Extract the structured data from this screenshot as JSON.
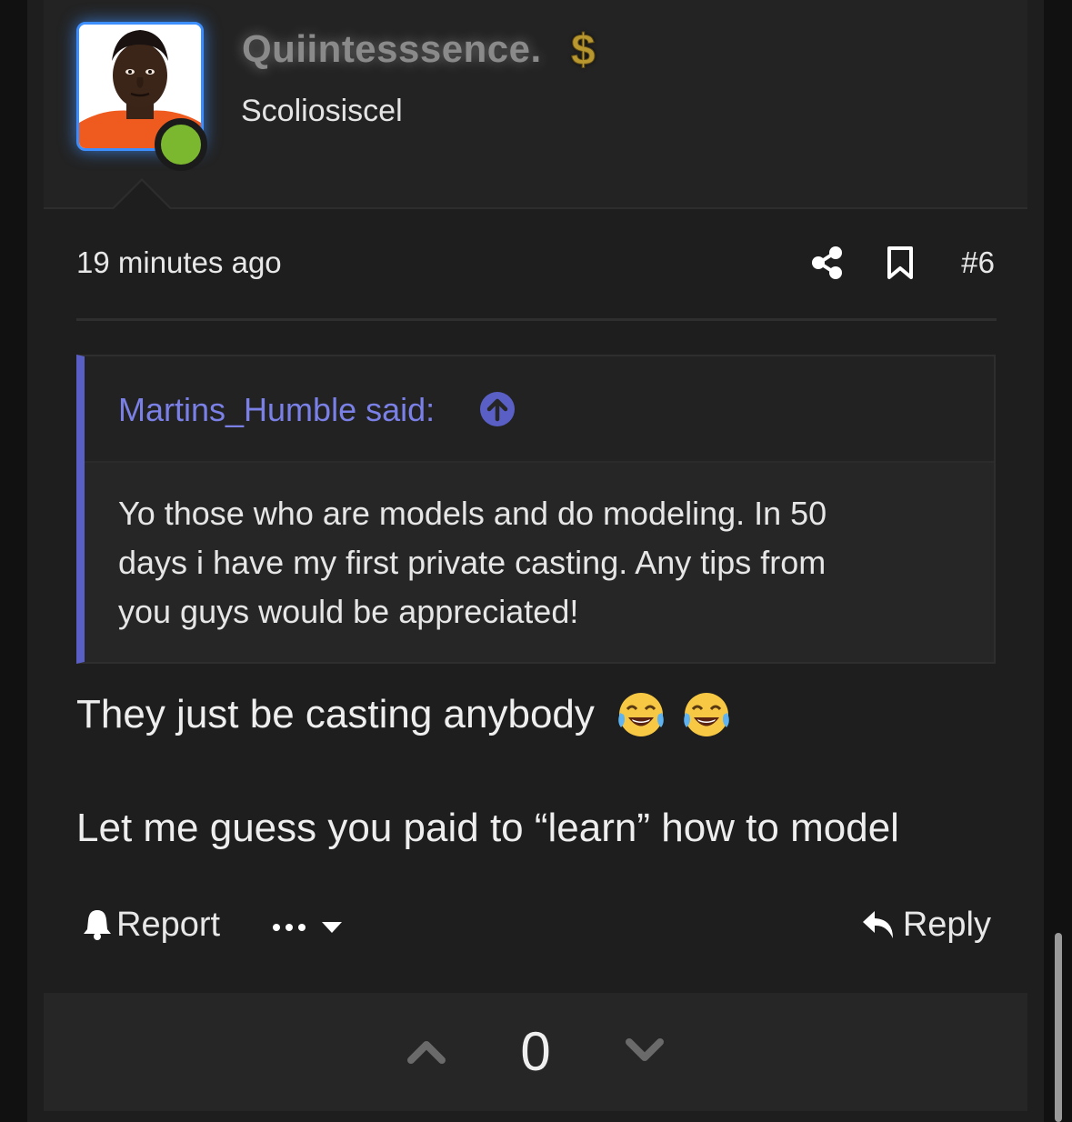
{
  "author": {
    "username": "Quiintesssence.",
    "title": "Scoliosiscel",
    "badge_icon": "dollar-icon",
    "online": true,
    "avatar_border_color": "#3d8fff",
    "online_color": "#7cb82f"
  },
  "post": {
    "timestamp": "19 minutes ago",
    "number": "#6",
    "icons": [
      "share-icon",
      "bookmark-icon"
    ]
  },
  "quote": {
    "author_label": "Martins_Humble said:",
    "accent_color": "#5a5fc6",
    "lines": [
      "Yo those who are models and do modeling. In 50",
      "days i have my first private casting. Any tips from",
      "you guys would be appreciated!"
    ]
  },
  "message": {
    "line1": "They just be casting anybody",
    "line1_emojis": [
      "tears-of-joy-emoji",
      "tears-of-joy-emoji"
    ],
    "line2": "Let me guess you paid to “learn” how to model"
  },
  "actions": {
    "report_label": "Report",
    "reply_label": "Reply"
  },
  "votes": {
    "count": "0"
  }
}
